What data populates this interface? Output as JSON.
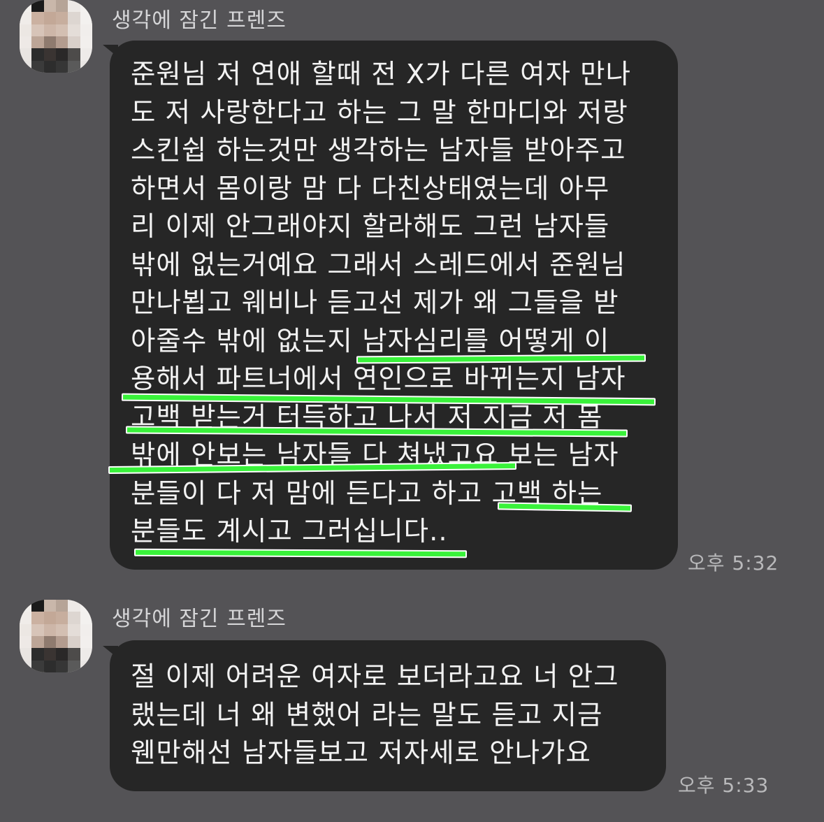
{
  "messages": [
    {
      "sender": "생각에 잠긴 프렌즈",
      "lines": [
        "준원님 저 연애 할때 전 X가 다른 여자 만나",
        "도 저 사랑한다고 하는 그 말 한마디와 저랑",
        "스킨쉽 하는것만 생각하는 남자들 받아주고",
        "하면서 몸이랑 맘 다 다친상태였는데 아무",
        "리 이제 안그래야지 할라해도 그런 남자들",
        "밖에 없는거예요 그래서 스레드에서 준원님",
        "만나뵙고 웨비나 듣고선 제가 왜 그들을 받",
        "아줄수 밖에 없는지 남자심리를 어떻게 이",
        "용해서 파트너에서 연인으로 바뀌는지 남자",
        "고백 받는거 터득하고 나서 저 지금 저 몸",
        "밖에 안보는 남자들 다 쳐냈고요 보는 남자",
        "분들이 다 저 맘에 든다고 하고 고백 하는",
        "분들도 계시고 그러십니다.."
      ],
      "time": "오후 5:32"
    },
    {
      "sender": "생각에 잠긴 프렌즈",
      "lines": [
        "절 이제 어려운 여자로 보더라고요 너 안그",
        "랬는데 너 왜 변했어 라는 말도 듣고 지금",
        "웬만해선 남자들보고 저자세로 안나가요"
      ],
      "time": "오후 5:33"
    }
  ],
  "highlight_color": "#39f23a"
}
